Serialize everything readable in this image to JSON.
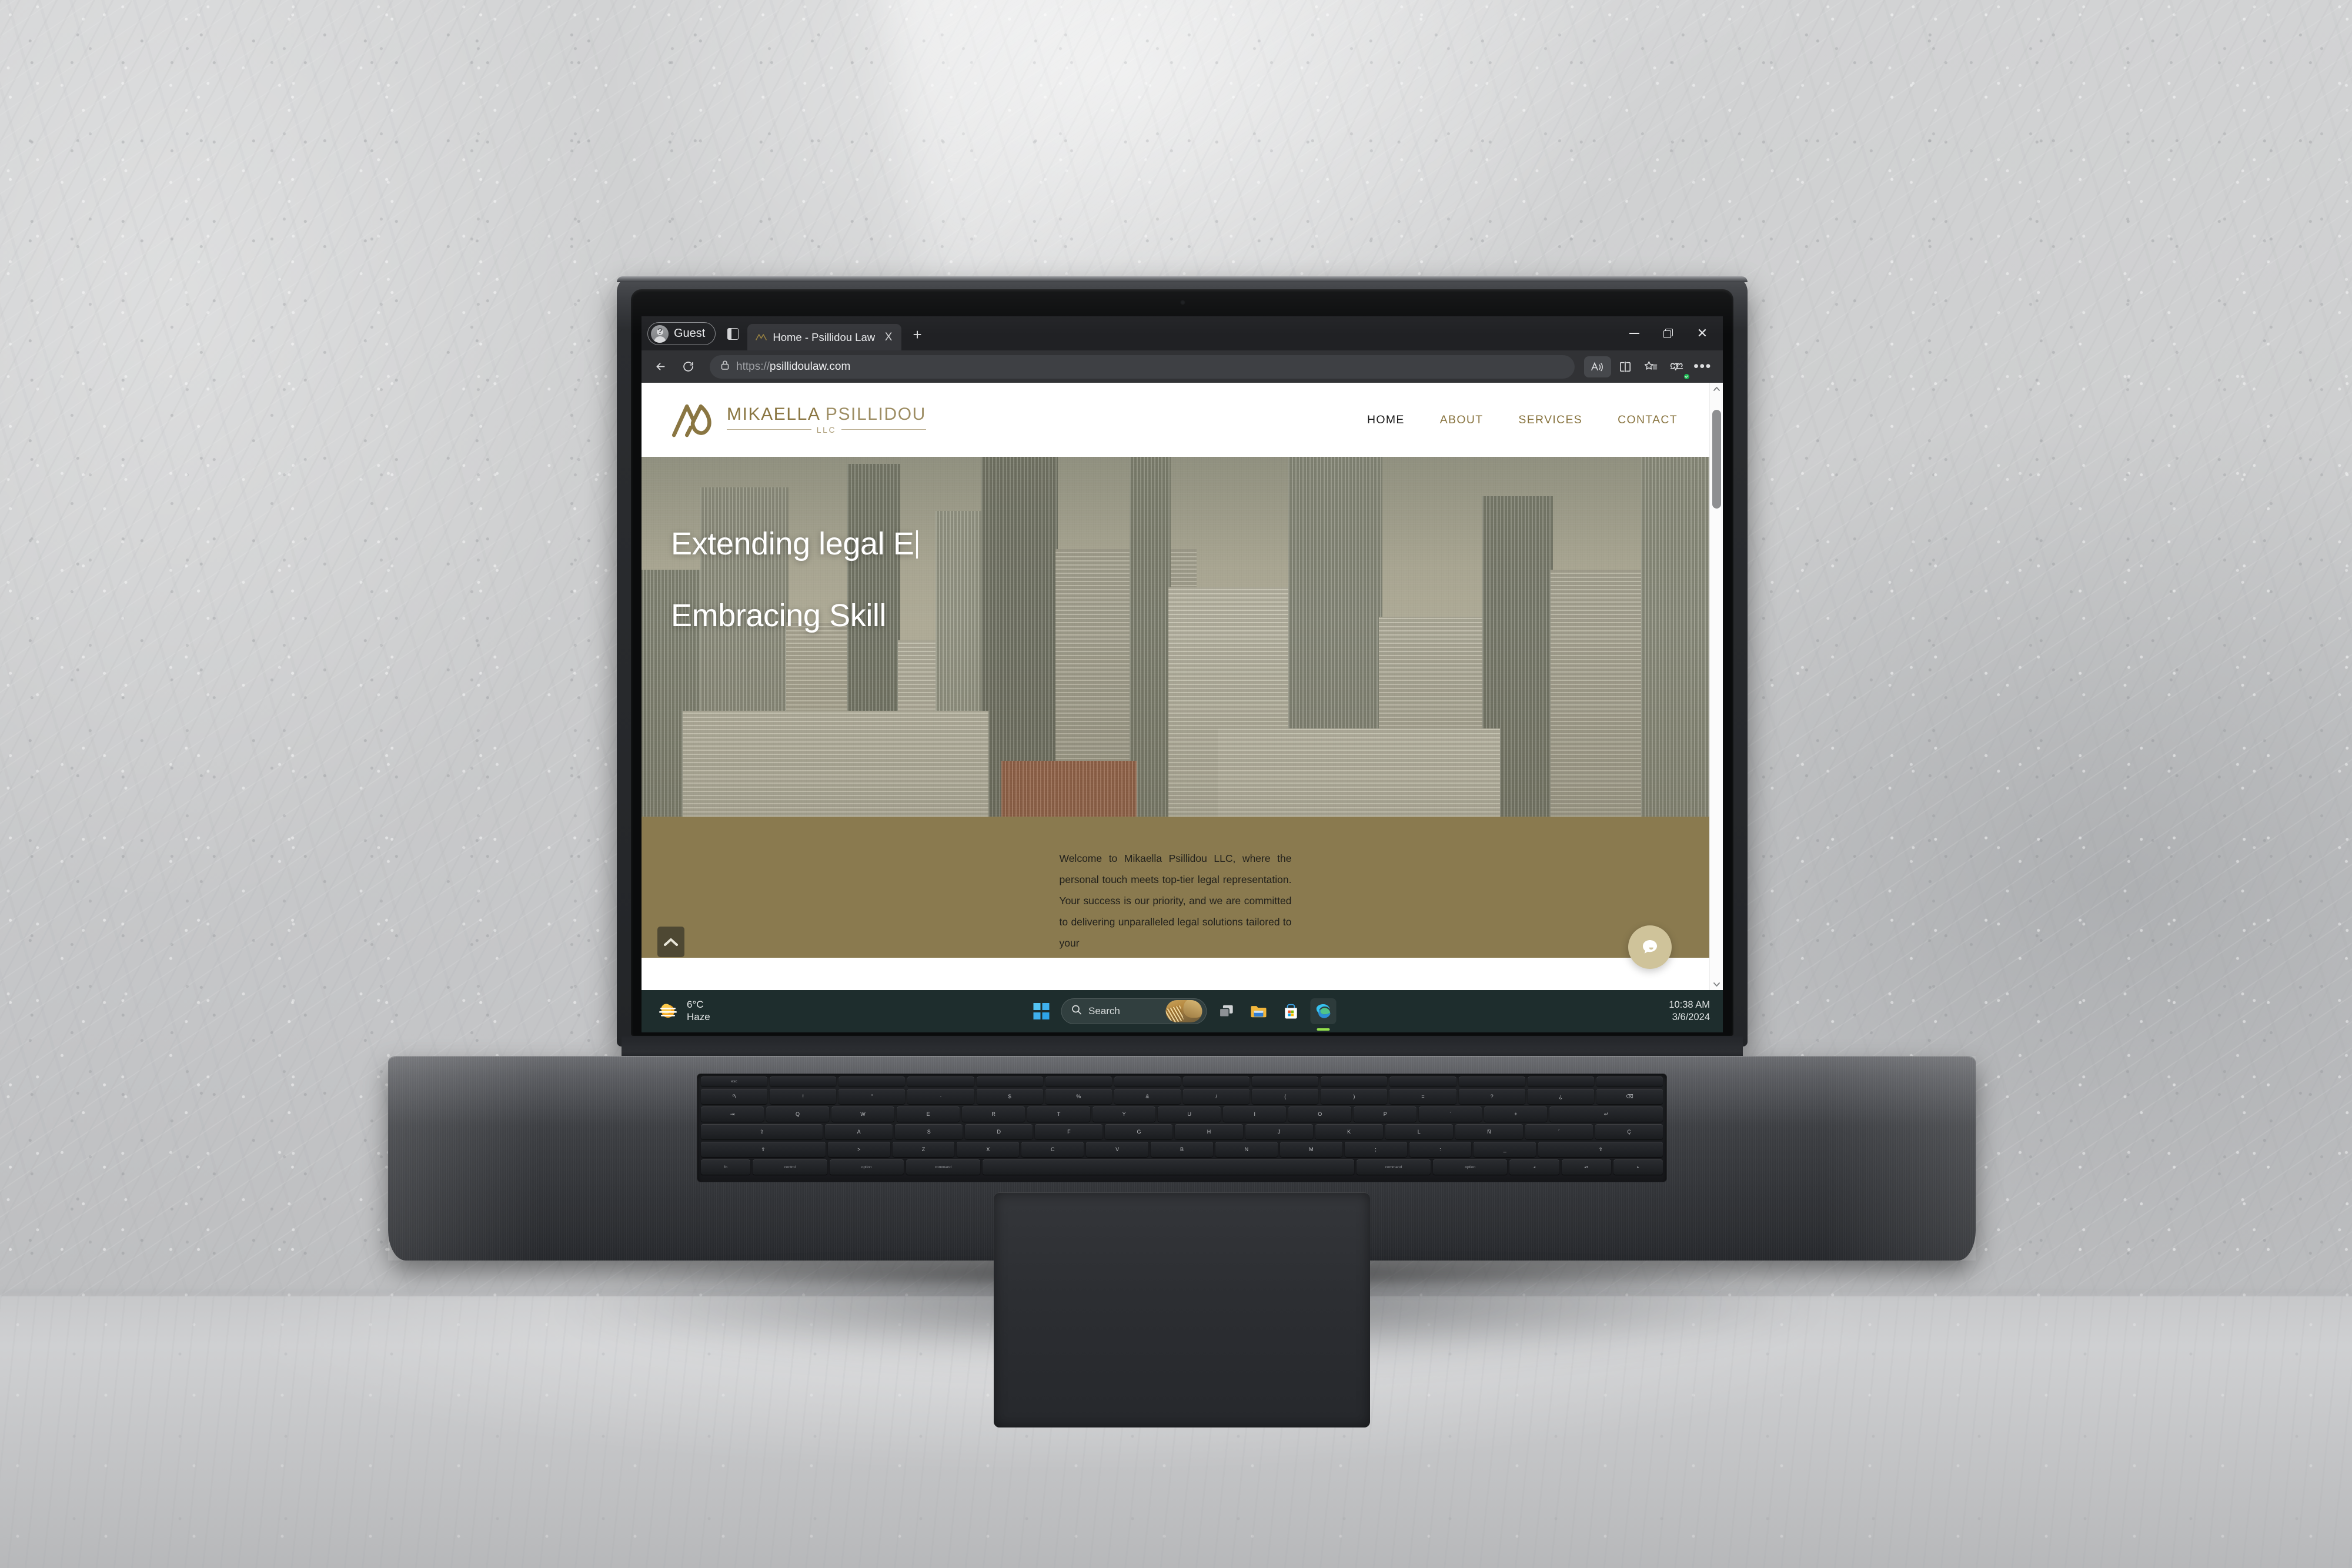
{
  "browser": {
    "profile_label": "Guest",
    "tab": {
      "title": "Home - Psillidou Law",
      "close_label": "X",
      "favicon_name": "psillidou-law-favicon"
    },
    "new_tab_label": "+",
    "address": {
      "scheme": "https://",
      "host": "psillidoulaw.com",
      "lock_icon": "lock-icon"
    },
    "window_controls": {
      "minimize": "minimize-icon",
      "restore": "restore-icon",
      "close": "close-icon"
    },
    "toolbar_icons": {
      "back": "back-arrow-icon",
      "refresh": "refresh-icon",
      "read_aloud": "read-aloud-icon",
      "split_screen": "split-screen-icon",
      "favorites": "favorites-star-icon",
      "browser_essentials": "browser-essentials-icon",
      "settings_more": "settings-and-more-icon"
    }
  },
  "site": {
    "logo": {
      "name_bold": "MIKAELLA",
      "name_thin": "PSILLIDOU",
      "suffix": "LLC"
    },
    "nav": [
      {
        "label": "HOME",
        "active": true
      },
      {
        "label": "ABOUT",
        "active": false
      },
      {
        "label": "SERVICES",
        "active": false
      },
      {
        "label": "CONTACT",
        "active": false
      }
    ],
    "hero": {
      "line1": "Extending legal E",
      "line2": "Embracing Skill"
    },
    "welcome": {
      "paragraph": "Welcome to Mikaella Psillidou LLC, where the personal touch meets top-tier legal representation. Your success is our priority, and we are committed to delivering unparalleled legal solutions tailored to your"
    },
    "chat_widget_icon": "chat-bubble-icon",
    "scroll_top_icon": "chevron-up-icon",
    "colors": {
      "gold": "#8a7642",
      "olive_band": "#8a7a4f",
      "chat_fab": "#cfc39a"
    }
  },
  "taskbar": {
    "weather": {
      "temperature": "6°C",
      "condition": "Haze",
      "icon": "haze-sun-icon"
    },
    "start_icon": "windows-start-icon",
    "search": {
      "placeholder": "Search",
      "icon": "search-icon"
    },
    "apps": [
      {
        "name": "task-view",
        "icon": "task-view-icon",
        "active": false
      },
      {
        "name": "file-explorer",
        "icon": "file-explorer-icon",
        "active": false
      },
      {
        "name": "microsoft-store",
        "icon": "microsoft-store-icon",
        "active": false
      },
      {
        "name": "microsoft-edge",
        "icon": "microsoft-edge-icon",
        "active": true
      }
    ],
    "clock": {
      "time": "10:38 AM",
      "date": "3/6/2024"
    }
  },
  "keyboard": {
    "row_fn": [
      "esc",
      "",
      "",
      "",
      "",
      "",
      "",
      "",
      "",
      "",
      "",
      "",
      "",
      ""
    ],
    "row_num": [
      "º\\",
      "!\n1",
      "\"\n2",
      "·\n3",
      "$\n4",
      "%\n5",
      "&\n6",
      "/\n7",
      "(\n8",
      ")\n9",
      "=\n0",
      "?\n'",
      "¿\n¡",
      "⌫"
    ],
    "row_q": [
      "⇥",
      "Q",
      "W",
      "E",
      "R",
      "T",
      "Y",
      "U",
      "I",
      "O",
      "P",
      "`\n^",
      "+\n*",
      "↵"
    ],
    "row_a": [
      "⇪",
      "A",
      "S",
      "D",
      "F",
      "G",
      "H",
      "J",
      "K",
      "L",
      "Ñ",
      "´\n¨",
      "Ç"
    ],
    "row_z": [
      "⇧",
      ">\n<",
      "Z",
      "X",
      "C",
      "V",
      "B",
      "N",
      "M",
      ";\n,",
      ":\n.",
      "_\n-",
      "⇧"
    ],
    "row_mod": [
      "fn",
      "control",
      "option",
      "command",
      "",
      "command",
      "option",
      "◂",
      "▴▾",
      "▸"
    ]
  }
}
